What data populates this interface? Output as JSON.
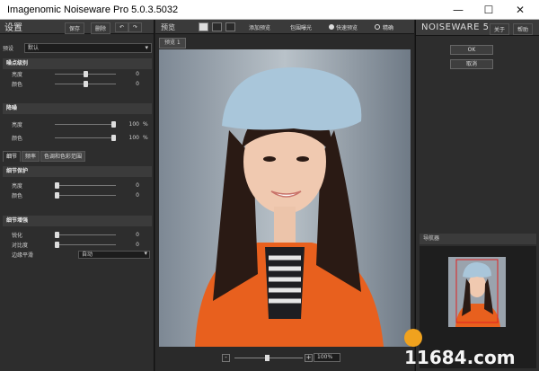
{
  "window": {
    "title": "Imagenomic Noiseware Pro 5.0.3.5032",
    "minimize": "—",
    "maximize": "☐",
    "close": "✕"
  },
  "left": {
    "title": "设置",
    "save_label": "保存",
    "delete_label": "删除",
    "preset_label": "预设",
    "preset_value": "默认",
    "noise_level": {
      "title": "噪点级别",
      "rows": [
        {
          "label": "亮度",
          "value": "0"
        },
        {
          "label": "颜色",
          "value": "0"
        }
      ]
    },
    "noise_reduction": {
      "title": "降噪",
      "rows": [
        {
          "label": "亮度",
          "value": "100",
          "unit": "%"
        },
        {
          "label": "颜色",
          "value": "100",
          "unit": "%"
        }
      ]
    },
    "tabs": [
      "细节",
      "频率",
      "色调和色彩范围"
    ],
    "detail_protection": {
      "title": "细节保护",
      "rows": [
        {
          "label": "亮度",
          "value": "0"
        },
        {
          "label": "颜色",
          "value": "0"
        }
      ]
    },
    "detail_enhance": {
      "title": "细节增强",
      "rows": [
        {
          "label": "锐化",
          "value": "0"
        },
        {
          "label": "对比度",
          "value": "0"
        }
      ],
      "edge_label": "边缘平滑",
      "edge_value": "自动"
    }
  },
  "center": {
    "preview_label": "预览",
    "add_preview": "添加预览",
    "pkg_exposure": "包围曝光",
    "fast_preview": "快速预览",
    "accurate": "精确",
    "preview_tab": "预览 1",
    "zoom_value": "100%",
    "zoom_minus": "-",
    "zoom_plus": "+"
  },
  "right": {
    "brand": "NOISEWARE 5",
    "about": "关于",
    "help": "帮助",
    "ok": "OK",
    "cancel": "取消",
    "navigator": "导航器"
  },
  "watermark": "11684.com"
}
